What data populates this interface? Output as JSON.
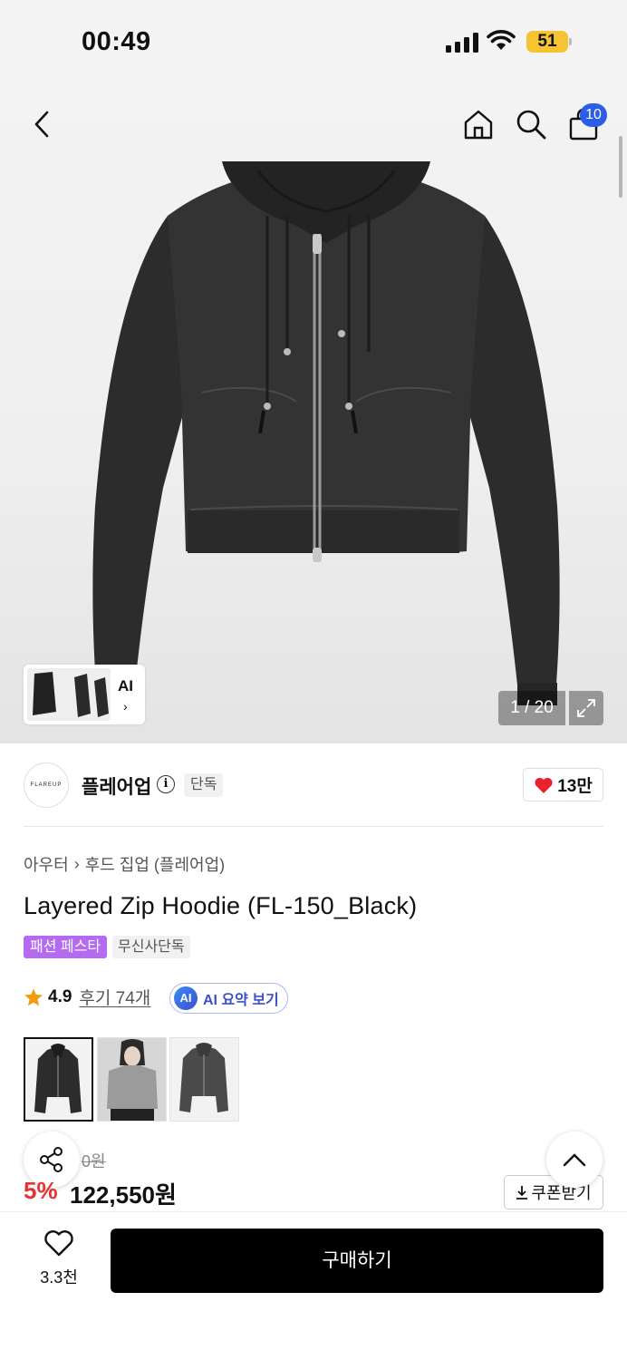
{
  "status_bar": {
    "time": "00:49",
    "battery": "51"
  },
  "header": {
    "cart_count": "10",
    "icons": [
      "back-icon",
      "home-icon",
      "search-icon",
      "cart-icon"
    ]
  },
  "gallery": {
    "ai_label": "AI",
    "counter": "1 / 20",
    "background_color": "#efefef"
  },
  "brand": {
    "logo_text": "FLAREUP",
    "name": "플레어업",
    "exclusive_tag": "단독",
    "likes": "13만",
    "heart_color": "#e8232f"
  },
  "breadcrumb": {
    "category": "아우터",
    "subcategory": "후드 집업 (플레어업)"
  },
  "product": {
    "title": "Layered Zip Hoodie (FL-150_Black)",
    "tags": [
      "패션 페스타",
      "무신사단독"
    ],
    "rating": "4.9",
    "reviews": "후기 74개",
    "ai_summary": "AI 요약 보기",
    "ai_badge": "AI",
    "original_price_partial": "0원",
    "discount": "5%",
    "price": "122,550원",
    "coupon": "쿠폰받기"
  },
  "bottom_bar": {
    "wish_count": "3.3천",
    "buy_label": "구매하기"
  },
  "colors": {
    "accent_purple": "#b46bf2",
    "discount_red": "#e8322f",
    "badge_blue": "#2b5de6",
    "buy_black": "#000000"
  }
}
